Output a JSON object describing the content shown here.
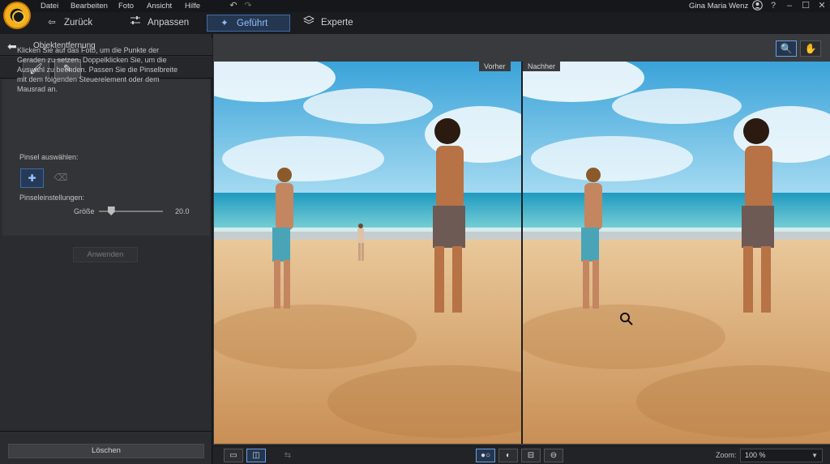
{
  "titlebar": {
    "menu": [
      "Datei",
      "Bearbeiten",
      "Foto",
      "Ansicht",
      "Hilfe"
    ],
    "user_name": "Gina Maria Wenz",
    "icons": [
      "undo-icon",
      "redo-icon",
      "account-icon",
      "help-icon",
      "minimize-icon",
      "maximize-icon",
      "close-icon"
    ]
  },
  "modes": {
    "back": "Zurück",
    "adjust": "Anpassen",
    "guided": "Geführt",
    "expert": "Experte"
  },
  "panel": {
    "title": "Objektentfernung",
    "instructions": "Klicken Sie auf das Foto, um die Punkte der Geraden zu setzen. Doppelklicken Sie, um die Auswahl zu beenden. Passen Sie die Pinselbreite mit dem folgenden Steuerelement oder dem Mausrad an.",
    "brush_select_label": "Pinsel auswählen:",
    "brush_settings_label": "Pinseleinstellungen:",
    "size_label": "Größe",
    "size_value": "20.0",
    "size_min": 1,
    "size_max": 100,
    "apply_label": "Anwenden",
    "clear_label": "Löschen"
  },
  "view": {
    "before_label": "Vorher",
    "after_label": "Nachher",
    "zoom_label": "Zoom:",
    "zoom_value": "100 %"
  },
  "colors": {
    "accent": "#3d6ca8",
    "accent_text": "#8fc0ff",
    "logo": "#f2b01e"
  }
}
